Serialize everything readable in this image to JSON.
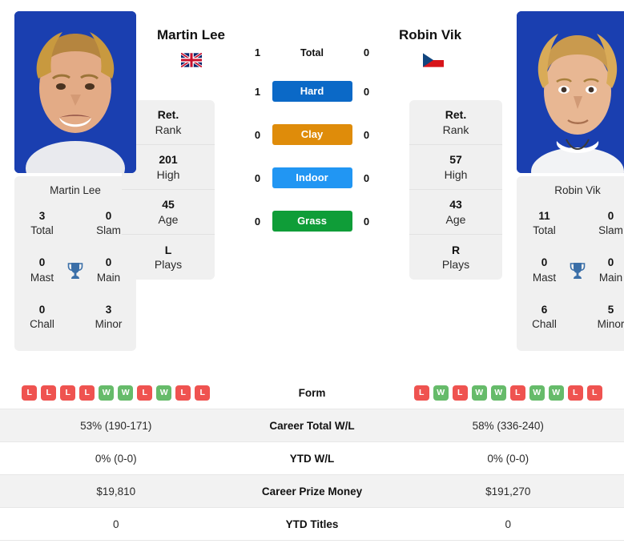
{
  "players": {
    "left": {
      "name": "Martin Lee",
      "flag": "uk-flag-icon",
      "photo": "player-photo-martin-lee",
      "titles": {
        "total_val": "3",
        "total_lab": "Total",
        "slam_val": "0",
        "slam_lab": "Slam",
        "mast_val": "0",
        "mast_lab": "Mast",
        "main_val": "0",
        "main_lab": "Main",
        "chall_val": "0",
        "chall_lab": "Chall",
        "minor_val": "3",
        "minor_lab": "Minor"
      },
      "ranks": [
        {
          "value": "Ret.",
          "label": "Rank"
        },
        {
          "value": "201",
          "label": "High"
        },
        {
          "value": "45",
          "label": "Age"
        },
        {
          "value": "L",
          "label": "Plays"
        }
      ],
      "form": [
        "L",
        "L",
        "L",
        "L",
        "W",
        "W",
        "L",
        "W",
        "L",
        "L"
      ],
      "career_total_wl": "53% (190-171)",
      "ytd_wl": "0% (0-0)",
      "career_prize_money": "$19,810",
      "ytd_titles": "0"
    },
    "right": {
      "name": "Robin Vik",
      "flag": "czech-flag-icon",
      "photo": "player-photo-robin-vik",
      "titles": {
        "total_val": "11",
        "total_lab": "Total",
        "slam_val": "0",
        "slam_lab": "Slam",
        "mast_val": "0",
        "mast_lab": "Mast",
        "main_val": "0",
        "main_lab": "Main",
        "chall_val": "6",
        "chall_lab": "Chall",
        "minor_val": "5",
        "minor_lab": "Minor"
      },
      "ranks": [
        {
          "value": "Ret.",
          "label": "Rank"
        },
        {
          "value": "57",
          "label": "High"
        },
        {
          "value": "43",
          "label": "Age"
        },
        {
          "value": "R",
          "label": "Plays"
        }
      ],
      "form": [
        "L",
        "W",
        "L",
        "W",
        "W",
        "L",
        "W",
        "W",
        "L",
        "L"
      ],
      "career_total_wl": "58% (336-240)",
      "ytd_wl": "0% (0-0)",
      "career_prize_money": "$191,270",
      "ytd_titles": "0"
    }
  },
  "h2h": {
    "total": {
      "label": "Total",
      "left": "1",
      "right": "0"
    },
    "surfaces": [
      {
        "label": "Hard",
        "left": "1",
        "right": "0",
        "color": "#0b69c7"
      },
      {
        "label": "Clay",
        "left": "0",
        "right": "0",
        "color": "#df8c0a"
      },
      {
        "label": "Indoor",
        "left": "0",
        "right": "0",
        "color": "#2196f3"
      },
      {
        "label": "Grass",
        "left": "0",
        "right": "0",
        "color": "#0f9d38"
      }
    ]
  },
  "stats_rows": {
    "form_label": "Form",
    "career_total_wl_label": "Career Total W/L",
    "ytd_wl_label": "YTD W/L",
    "career_prize_money_label": "Career Prize Money",
    "ytd_titles_label": "YTD Titles"
  },
  "colors": {
    "hard": "#0b69c7",
    "clay": "#df8c0a",
    "indoor": "#2196f3",
    "grass": "#0f9d38",
    "win": "#66bb6a",
    "loss": "#ef5350",
    "trophy": "#3b6fa8",
    "panel": "#f0f0f0"
  }
}
